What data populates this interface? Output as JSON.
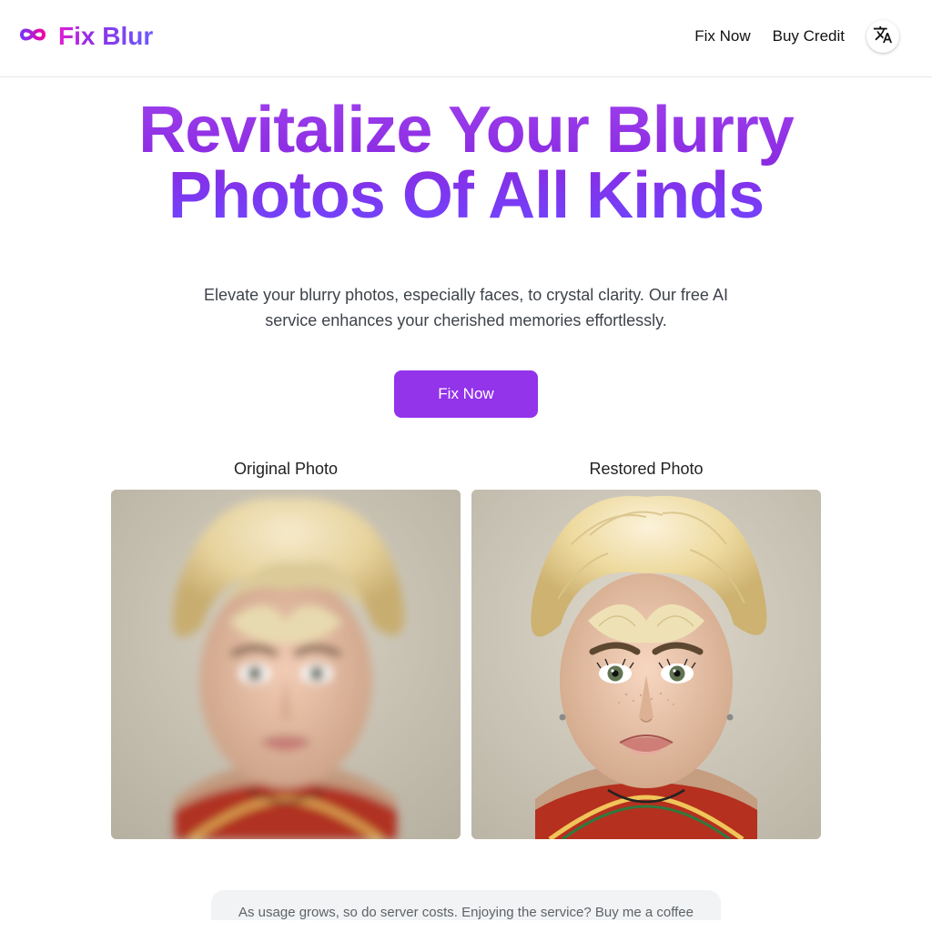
{
  "brand": {
    "name": "Fix Blur"
  },
  "nav": {
    "fix_now": "Fix Now",
    "buy_credit": "Buy Credit",
    "language_icon": "translate-icon"
  },
  "hero": {
    "title": "Revitalize Your Blurry Photos Of All Kinds",
    "subtitle": "Elevate your blurry photos, especially faces, to crystal clarity. Our free AI service enhances your cherished memories effortlessly.",
    "cta_label": "Fix Now"
  },
  "compare": {
    "original_label": "Original Photo",
    "restored_label": "Restored Photo"
  },
  "banner": {
    "text": "As usage grows, so do server costs. Enjoying the service? Buy me a coffee"
  }
}
